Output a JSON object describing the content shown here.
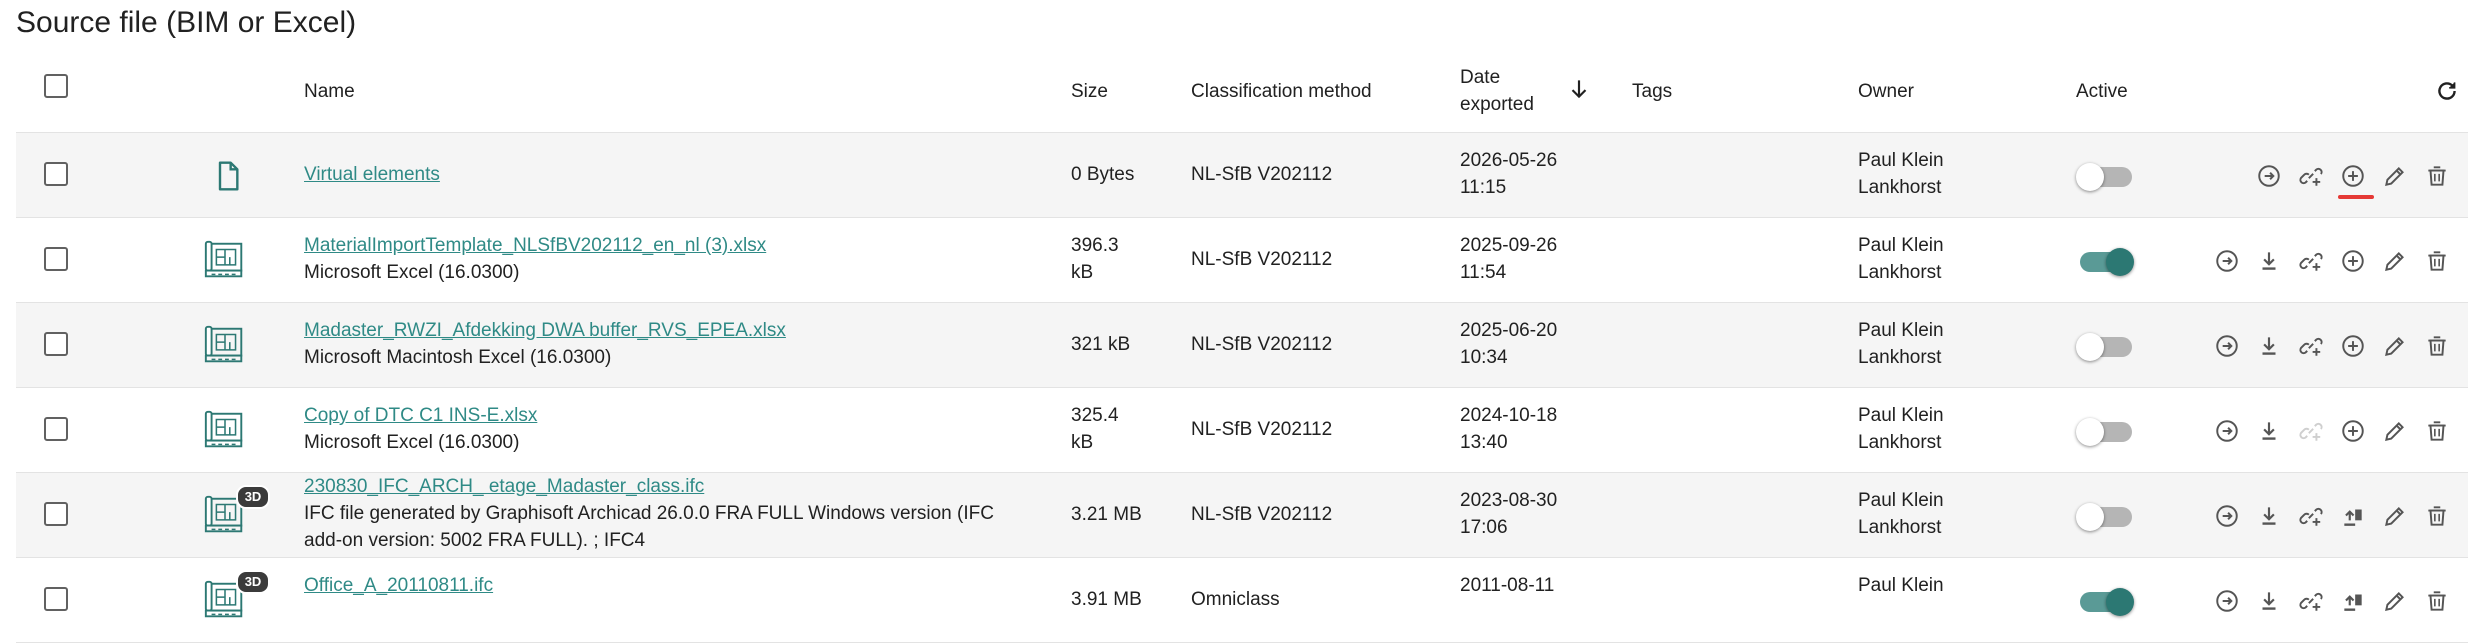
{
  "page": {
    "title": "Source file (BIM or Excel)"
  },
  "table": {
    "headers": {
      "name": "Name",
      "size": "Size",
      "classification": "Classification method",
      "date_line1": "Date",
      "date_line2": "exported",
      "tags": "Tags",
      "owner": "Owner",
      "active": "Active"
    },
    "rows": [
      {
        "name": "Virtual elements",
        "description": "",
        "size_l1": "0 Bytes",
        "size_l2": "",
        "classification": "NL-SfB V202112",
        "date": "2026-05-26",
        "time": "11:15",
        "owner_l1": "Paul Klein",
        "owner_l2": "Lankhorst",
        "active": false,
        "icon": "document-icon",
        "badge": ""
      },
      {
        "name": "MaterialImportTemplate_NLSfBV202112_en_nl (3).xlsx",
        "description": "Microsoft Excel (16.0300)",
        "size_l1": "396.3",
        "size_l2": "kB",
        "classification": "NL-SfB V202112",
        "date": "2025-09-26",
        "time": "11:54",
        "owner_l1": "Paul Klein",
        "owner_l2": "Lankhorst",
        "active": true,
        "icon": "building-plan-icon",
        "badge": ""
      },
      {
        "name": "Madaster_RWZI_Afdekking DWA buffer_RVS_EPEA.xlsx",
        "description": "Microsoft Macintosh Excel (16.0300)",
        "size_l1": "321 kB",
        "size_l2": "",
        "classification": "NL-SfB V202112",
        "date": "2025-06-20",
        "time": "10:34",
        "owner_l1": "Paul Klein",
        "owner_l2": "Lankhorst",
        "active": false,
        "icon": "building-plan-icon",
        "badge": ""
      },
      {
        "name": "Copy of DTC C1 INS-E.xlsx",
        "description": "Microsoft Excel (16.0300)",
        "size_l1": "325.4",
        "size_l2": "kB",
        "classification": "NL-SfB V202112",
        "date": "2024-10-18",
        "time": "13:40",
        "owner_l1": "Paul Klein",
        "owner_l2": "Lankhorst",
        "active": false,
        "icon": "building-plan-icon",
        "badge": ""
      },
      {
        "name": "230830_IFC_ARCH_ etage_Madaster_class.ifc",
        "description_l1": "IFC file generated by Graphisoft Archicad 26.0.0 FRA FULL Windows version (IFC",
        "description_l2": "add-on version: 5002 FRA FULL). ; IFC4",
        "size_l1": "3.21 MB",
        "size_l2": "",
        "classification": "NL-SfB V202112",
        "date": "2023-08-30",
        "time": "17:06",
        "owner_l1": "Paul Klein",
        "owner_l2": "Lankhorst",
        "active": false,
        "icon": "building-plan-icon",
        "badge": "3D"
      },
      {
        "name": "Office_A_20110811.ifc",
        "size_l1": "3.91 MB",
        "classification": "Omniclass",
        "date": "2011-08-11",
        "owner_l1": "Paul Klein",
        "active": true,
        "icon": "building-plan-icon",
        "badge": "3D"
      }
    ]
  },
  "colors": {
    "accent": "#2c7873",
    "link": "#2f8a86",
    "highlight": "#e53935"
  }
}
